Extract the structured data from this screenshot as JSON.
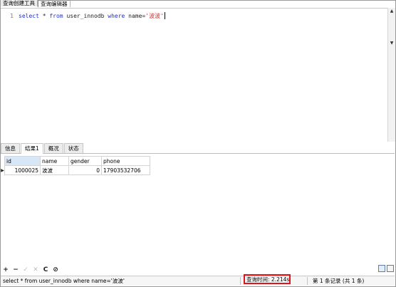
{
  "top_tabs": [
    "查询创建工具",
    "查询编辑器"
  ],
  "editor": {
    "line_number": "1",
    "tokens": {
      "select": "select",
      "star": " * ",
      "from": "from",
      "table": " user_innodb ",
      "where": "where",
      "name": " name=",
      "value": "'波波'"
    }
  },
  "result_tabs": [
    "信息",
    "结果1",
    "概况",
    "状态"
  ],
  "grid": {
    "columns": [
      "id",
      "name",
      "gender",
      "phone"
    ],
    "rows": [
      {
        "id": "1000025",
        "name": "波波",
        "gender": "0",
        "phone": "17903532706"
      }
    ]
  },
  "toolbar": {
    "add": "+",
    "remove": "−",
    "apply": "✓",
    "cancel": "✕",
    "refresh": "C",
    "stop": "⊘"
  },
  "status": {
    "sql": "select * from user_innodb where name='波波'",
    "query_time": "查询时间: 2.214s",
    "records": "第 1 条记录 (共 1 条)"
  },
  "colors": {
    "keyword": "#2030c8",
    "string": "#d43030",
    "highlight_box": "#e0151b"
  }
}
